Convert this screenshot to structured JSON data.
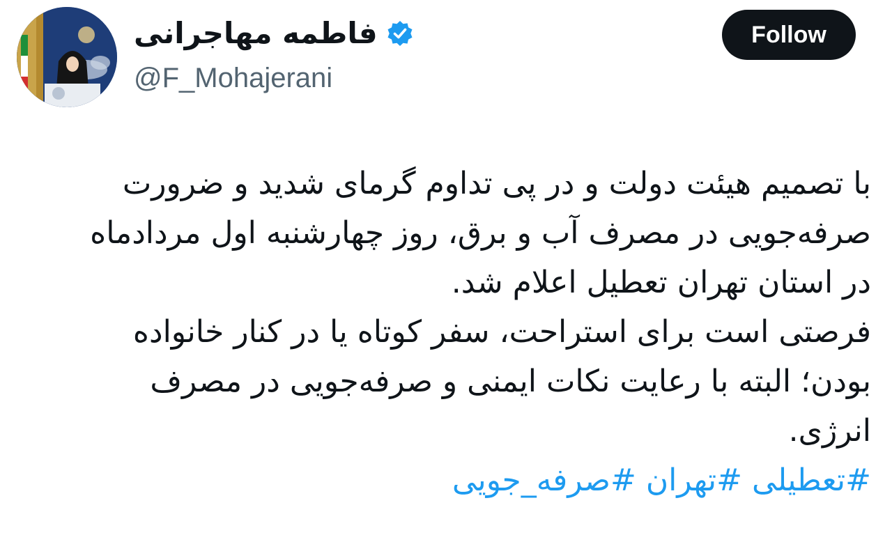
{
  "profile": {
    "display_name": "فاطمه مهاجرانی",
    "handle": "@F_Mohajerani",
    "verified": true,
    "verified_color": "#1d9bf0",
    "avatar_icon": "profile-photo"
  },
  "follow_button": {
    "label": "Follow",
    "bg_color": "#0f1419",
    "text_color": "#ffffff"
  },
  "tweet": {
    "lines": [
      "با تصمیم هیئت دولت و در پی تداوم گرمای شدید و ضرورت",
      "صرفه‌جویی در مصرف آب و برق، روز چهارشنبه اول مردادماه",
      "در استان تهران تعطیل اعلام شد.",
      "فرصتی است برای استراحت، سفر کوتاه یا در کنار خانواده",
      "بودن؛ البته با رعایت نکات ایمنی و صرفه‌جویی در مصرف",
      "انرژی."
    ],
    "hashtags": [
      "#تعطیلی",
      "#تهران",
      "#صرفه_جویی"
    ],
    "hashtag_color": "#1d9bf0"
  }
}
